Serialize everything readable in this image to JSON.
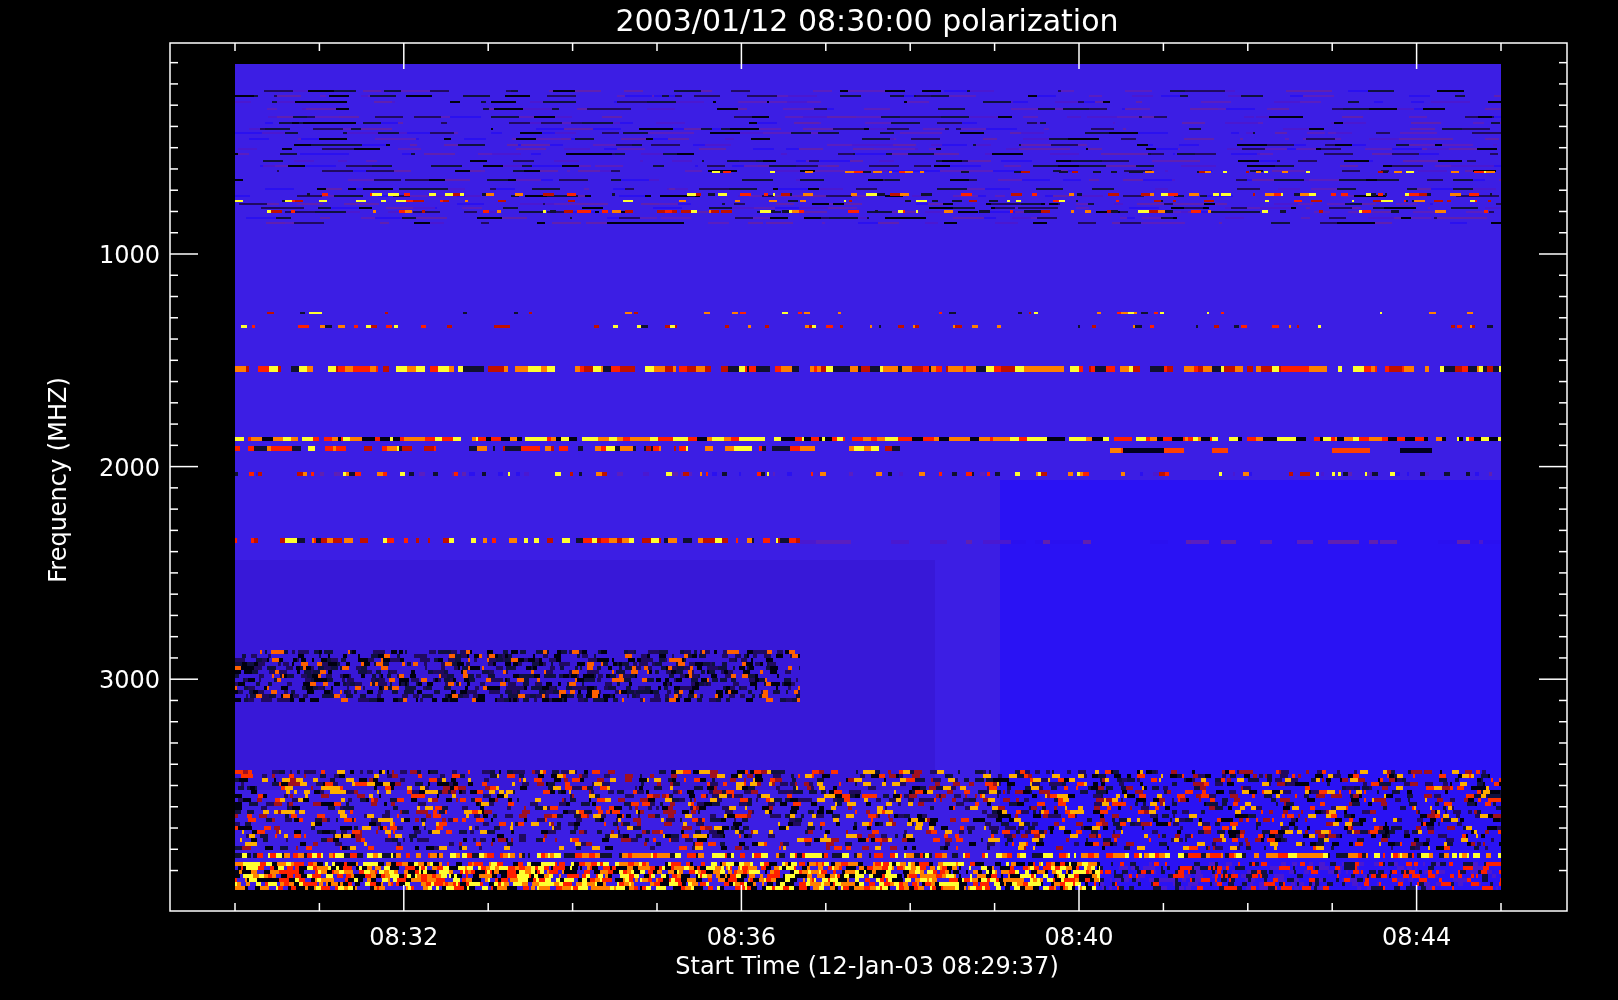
{
  "plot": {
    "title": "2003/01/12 08:30:00 polarization",
    "xlabel": "Start Time (12-Jan-03 08:29:37)",
    "ylabel": "Frequency (MHZ)",
    "xticks": [
      "08:32",
      "08:36",
      "08:40",
      "08:44"
    ],
    "yticks": [
      "1000",
      "2000",
      "3000"
    ]
  }
}
